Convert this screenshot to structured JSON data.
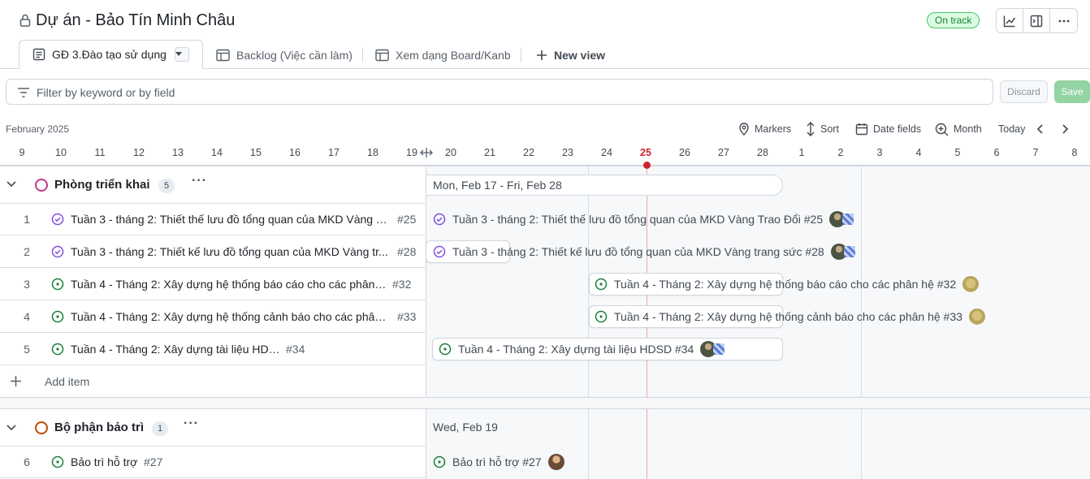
{
  "header": {
    "title": "Dự án - Bảo Tín Minh Châu",
    "status": "On track"
  },
  "tabs": [
    {
      "label": "GĐ 3.Đào tạo sử dụng",
      "active": true
    },
    {
      "label": "Backlog (Việc cần làm)"
    },
    {
      "label": "Xem dạng Board/Kanb"
    },
    {
      "label": "New view"
    }
  ],
  "filter": {
    "placeholder": "Filter by keyword or by field",
    "discard_label": "Discard",
    "save_label": "Save"
  },
  "toolbar": {
    "month_label": "February 2025",
    "markers": "Markers",
    "sort": "Sort",
    "date_fields": "Date fields",
    "zoom": "Month",
    "today": "Today"
  },
  "days": [
    "9",
    "10",
    "11",
    "12",
    "13",
    "14",
    "15",
    "16",
    "17",
    "18",
    "19",
    "20",
    "21",
    "22",
    "23",
    "24",
    "25",
    "26",
    "27",
    "28",
    "1",
    "2",
    "3",
    "4",
    "5",
    "6",
    "7",
    "8"
  ],
  "today_day": "25",
  "groups": [
    {
      "name": "Phòng triển khai",
      "count": "5",
      "color": "#bf3989",
      "range_label": "Mon, Feb 17 - Fri, Feb 28",
      "rows": [
        {
          "num": "1",
          "title": "Tuần 3 - tháng 2: Thiết thế lưu đồ tổng quan của MKD Vàng T...",
          "issue": "#25",
          "bar_label": "Tuần 3 - tháng 2: Thiết thế lưu đồ tổng quan của MKD Vàng Trao Đổi #25",
          "status": "done"
        },
        {
          "num": "2",
          "title": "Tuần 3 - tháng 2: Thiết kế lưu đồ tổng quan của MKD Vàng tr...",
          "issue": "#28",
          "bar_label": "Tuần 3 - tháng 2: Thiết kế lưu đồ tổng quan của MKD Vàng trang sức #28",
          "status": "done"
        },
        {
          "num": "3",
          "title": "Tuần 4 - Tháng 2: Xây dựng hệ thống báo cáo cho các phân hệ",
          "issue": "#32",
          "bar_label": "Tuần 4 - Tháng 2: Xây dựng hệ thống báo cáo cho các phân hệ #32",
          "status": "open"
        },
        {
          "num": "4",
          "title": "Tuần 4 - Tháng 2: Xây dựng hệ thống cảnh báo cho các phân ...",
          "issue": "#33",
          "bar_label": "Tuần 4 - Tháng 2: Xây dựng hệ thống cảnh báo cho các phân hệ #33",
          "status": "open"
        },
        {
          "num": "5",
          "title": "Tuần 4 - Tháng 2: Xây dựng tài liệu HDSD",
          "issue": "#34",
          "bar_label": "Tuần 4 - Tháng 2: Xây dựng tài liệu HDSD #34",
          "status": "open"
        }
      ],
      "add_item": "Add item"
    },
    {
      "name": "Bộ phận bảo trì",
      "count": "1",
      "color": "#bc4c00",
      "range_label": "Wed, Feb 19",
      "rows": [
        {
          "num": "6",
          "title": "Bảo trì hỗ trợ",
          "issue": "#27",
          "bar_label": "Bảo trì hỗ trợ #27",
          "status": "open"
        }
      ]
    }
  ],
  "icons": {
    "lock": "lock-icon",
    "insights": "graph-icon",
    "sidepanel": "sidebar-icon",
    "more": "kebab-horizontal-icon",
    "filter": "filter-icon",
    "markers": "location-icon",
    "sort": "sort-icon",
    "date": "calendar-icon",
    "zoom": "zoom-in-icon"
  },
  "colors": {
    "accent_green": "#1a7f37",
    "done_purple": "#8250df",
    "today_red": "#cf222e"
  }
}
